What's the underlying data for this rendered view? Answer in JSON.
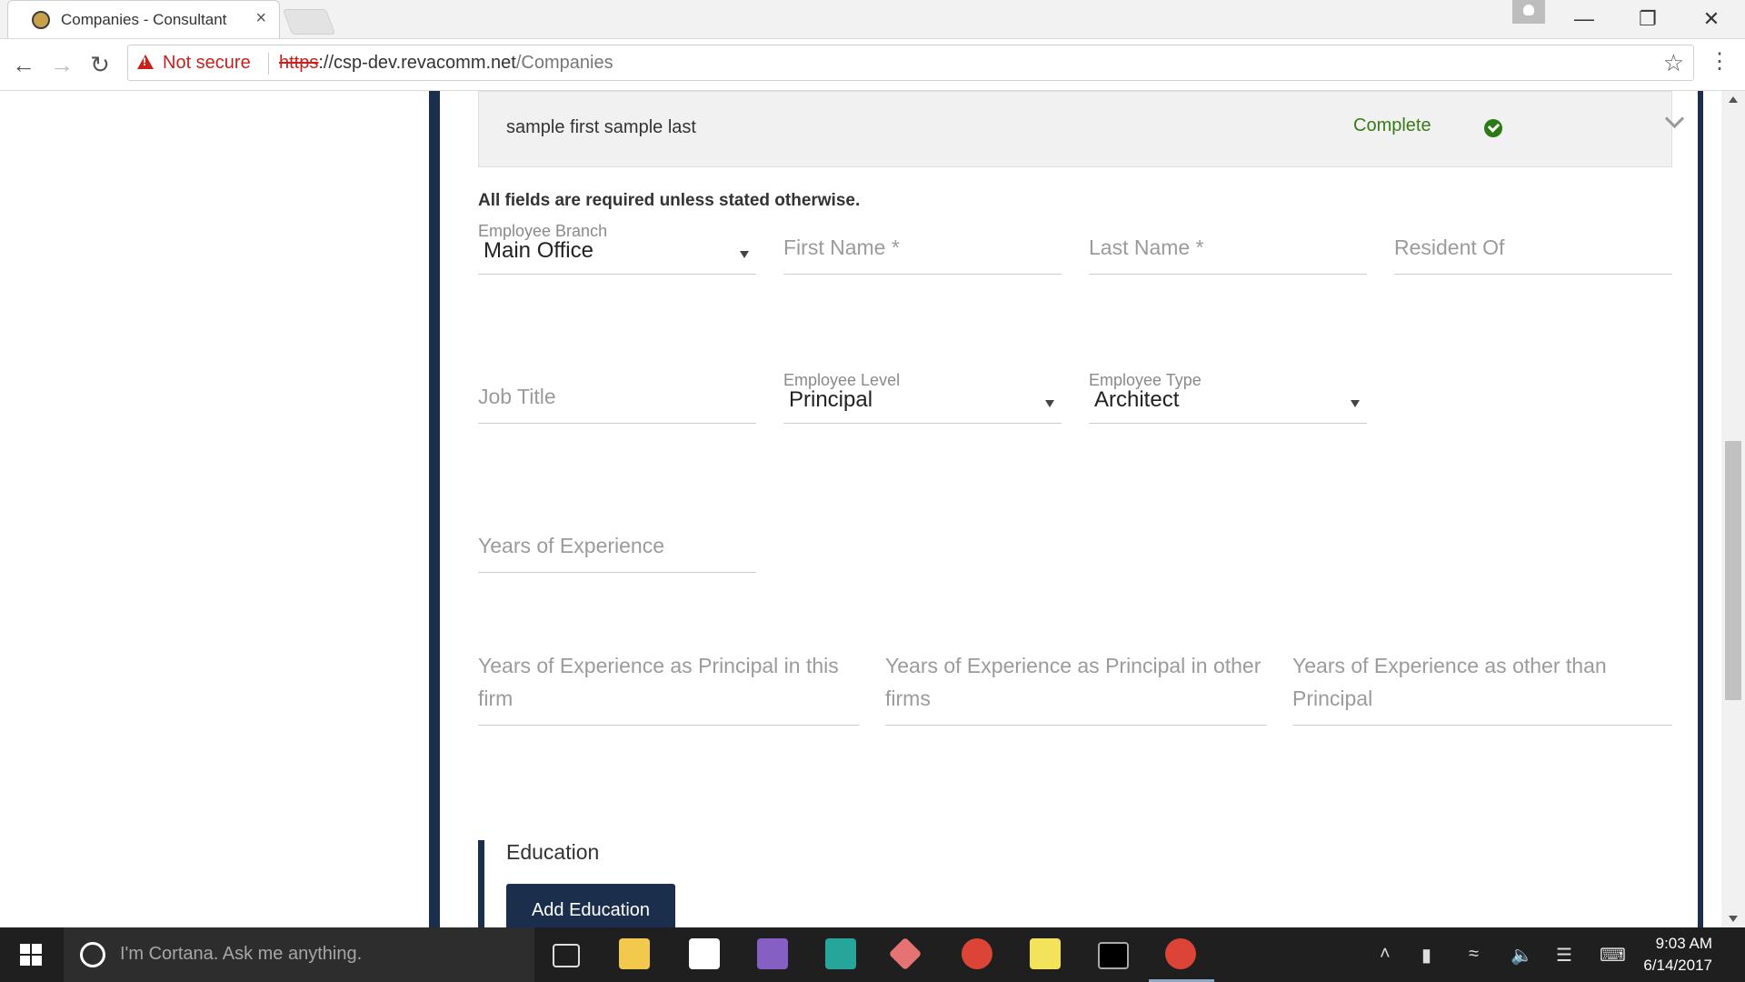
{
  "browser": {
    "tab_title": "Companies - Consultant",
    "tab_close": "×",
    "security_label": "Not secure",
    "url_scheme": "https",
    "url_host": "://csp-dev.revacomm.net",
    "url_path": "/Companies"
  },
  "accordion": {
    "name": "sample first sample last",
    "status": "Complete",
    "status_color": "#3a7b17"
  },
  "form": {
    "required_note": "All fields are required unless stated otherwise.",
    "employee_branch": {
      "label": "Employee Branch",
      "value": "Main Office"
    },
    "first_name": {
      "placeholder": "First Name *"
    },
    "last_name": {
      "placeholder": "Last Name *"
    },
    "resident_of": {
      "placeholder": "Resident Of"
    },
    "job_title": {
      "placeholder": "Job Title"
    },
    "employee_level": {
      "label": "Employee Level",
      "value": "Principal"
    },
    "employee_type": {
      "label": "Employee Type",
      "value": "Architect"
    },
    "years_experience": {
      "placeholder": "Years of Experience"
    },
    "years_principal_this_firm": {
      "placeholder": "Years of Experience as Principal in this firm"
    },
    "years_principal_other_firms": {
      "placeholder": "Years of Experience as Principal in other firms"
    },
    "years_other_than_principal": {
      "placeholder": "Years of Experience as other than Principal"
    }
  },
  "education": {
    "title": "Education",
    "add_button": "Add Education"
  },
  "taskbar": {
    "cortana_placeholder": "I'm Cortana. Ask me anything.",
    "time": "9:03 AM",
    "date": "6/14/2017"
  },
  "colors": {
    "frame": "#1b2e4c",
    "accent_button": "#1b2e4c",
    "warning": "#c5221f"
  }
}
